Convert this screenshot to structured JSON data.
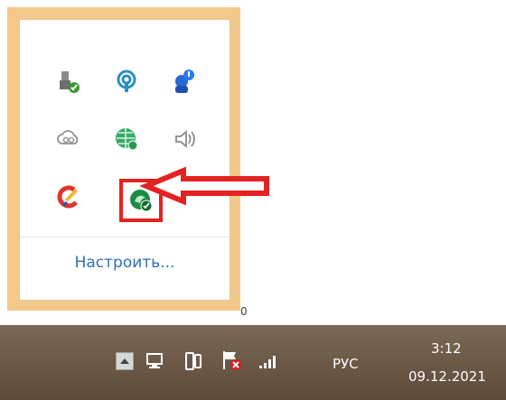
{
  "tray_popup": {
    "configure_label": "Настроить...",
    "icons": [
      {
        "name": "usb-safe-remove-icon",
        "interactable": true
      },
      {
        "name": "wireless-antenna-icon",
        "interactable": true
      },
      {
        "name": "bluetooth-person-icon",
        "interactable": true
      },
      {
        "name": "creative-cloud-icon",
        "interactable": true
      },
      {
        "name": "green-globe-icon",
        "interactable": true
      },
      {
        "name": "speaker-icon",
        "interactable": true
      },
      {
        "name": "ccleaner-icon",
        "interactable": true
      },
      {
        "name": "green-vpn-icon",
        "interactable": true
      }
    ],
    "highlight_color": "#e32222",
    "border_color": "#f2c98a"
  },
  "taskbar": {
    "language": "РУС",
    "time": "3:12",
    "date": "09.12.2021",
    "icons": [
      "show-hidden-icons-button",
      "network-icon",
      "phone-icon",
      "flag-error-icon",
      "signal-bars-icon"
    ]
  },
  "partial_text": "0"
}
